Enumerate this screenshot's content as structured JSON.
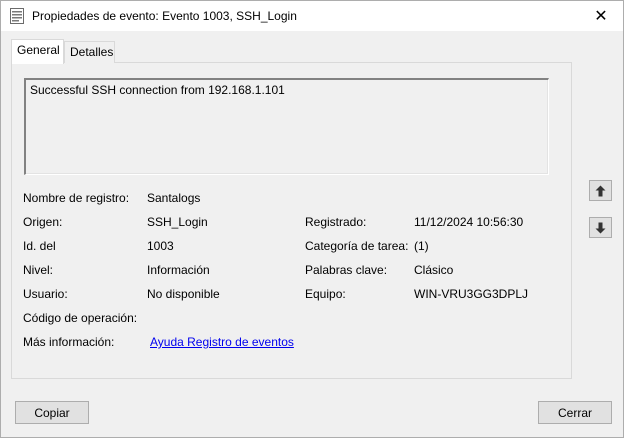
{
  "window": {
    "title": "Propiedades de evento: Evento 1003, SSH_Login",
    "close_glyph": "✕"
  },
  "tabs": [
    {
      "label": "General",
      "active": true
    },
    {
      "label": "Detalles",
      "active": false
    }
  ],
  "general": {
    "description": "Successful SSH connection from 192.168.1.101",
    "fields_left": [
      {
        "label": "Nombre de registro:",
        "value": "Santalogs"
      },
      {
        "label": "Origen:",
        "value": "SSH_Login"
      },
      {
        "label": "Id. del",
        "value": "1003"
      },
      {
        "label": "Nivel:",
        "value": "Información"
      },
      {
        "label": "Usuario:",
        "value": "No disponible"
      },
      {
        "label": "Código de operación:",
        "value": ""
      },
      {
        "label": "Más información:",
        "value": "Ayuda Registro de eventos"
      }
    ],
    "fields_right": [
      {
        "label": "Registrado:",
        "value": "11/12/2024 10:56:30"
      },
      {
        "label": "Categoría de tarea:",
        "value": "(1)"
      },
      {
        "label": "Palabras clave:",
        "value": "Clásico"
      },
      {
        "label": "Equipo:",
        "value": "WIN-VRU3GG3DPLJ"
      }
    ]
  },
  "navigation": {
    "up_icon": "arrow-up-icon",
    "down_icon": "arrow-down-icon"
  },
  "buttons": {
    "copy": "Copiar",
    "close": "Cerrar"
  }
}
